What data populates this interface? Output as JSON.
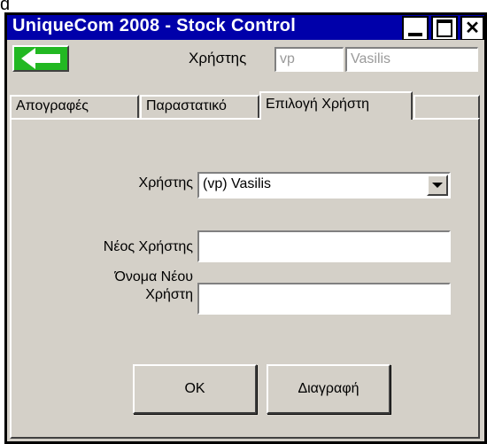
{
  "window": {
    "title": "UniqueCom 2008 - Stock Control",
    "stray_char": "d",
    "titlebar_color": "#0000aa"
  },
  "icons": {
    "back": "arrow-left-icon",
    "minimize": "minimize-icon",
    "maximize": "maximize-icon",
    "close": "close-icon",
    "dropdown": "chevron-down-icon"
  },
  "toolbar": {
    "user_label": "Χρήστης",
    "user_code": "vp",
    "user_name": "Vasilis",
    "back_button_color": "#22b822"
  },
  "tabs": [
    {
      "label": "Απογραφές",
      "active": false
    },
    {
      "label": "Παραστατικό",
      "active": false
    },
    {
      "label": "Επιλογή Χρήστη",
      "active": true
    }
  ],
  "form": {
    "user_label": "Χρήστης",
    "user_selected": "(vp) Vasilis",
    "new_user_label": "Νέος Χρήστης",
    "new_user_value": "",
    "new_user_name_label": "Όνομα Νέου Χρήστη",
    "new_user_name_value": ""
  },
  "buttons": {
    "ok": "OK",
    "delete": "Διαγραφή"
  }
}
